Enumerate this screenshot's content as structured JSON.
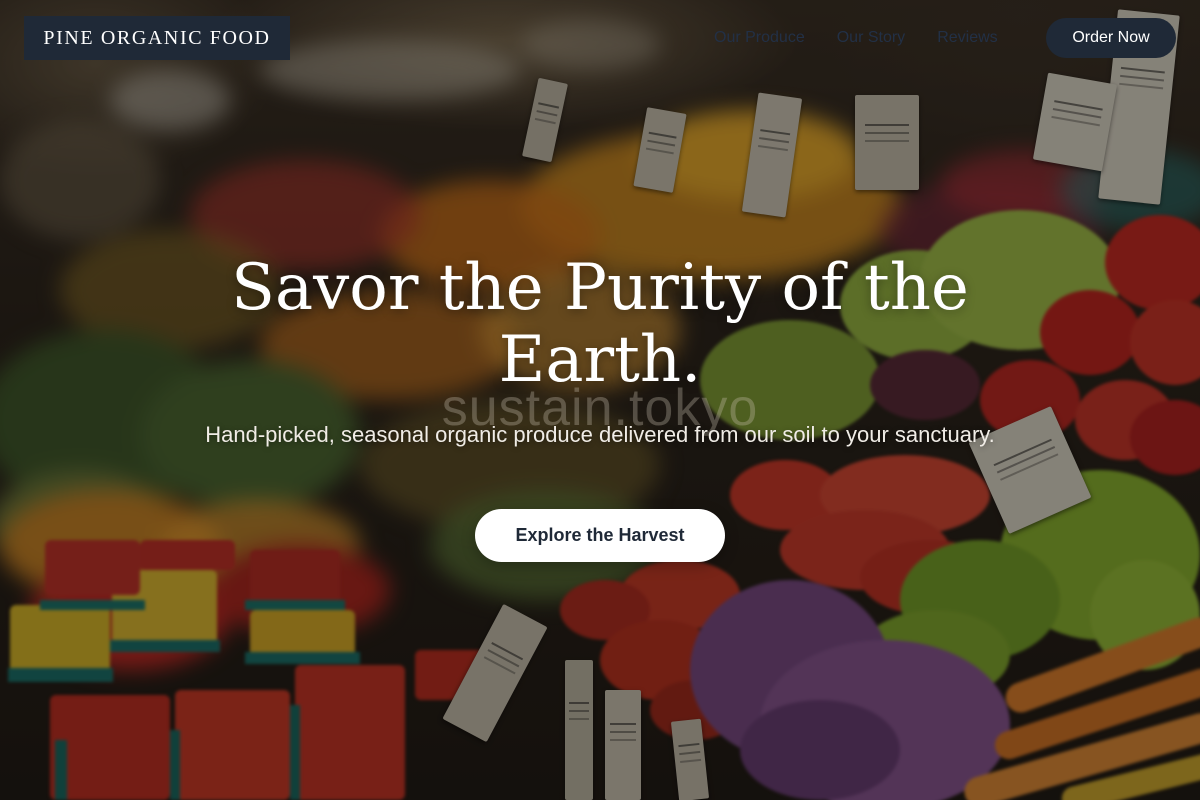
{
  "header": {
    "brand": "PINE ORGANIC FOOD",
    "nav": [
      {
        "label": "Our Produce"
      },
      {
        "label": "Our Story"
      },
      {
        "label": "Reviews"
      }
    ],
    "cta_label": "Order Now"
  },
  "hero": {
    "title": "Savor the Purity of the Earth.",
    "subtitle": "Hand-picked, seasonal organic produce delivered from our soil to your sanctuary.",
    "button_label": "Explore the Harvest",
    "watermark": "sustain.tokyo"
  },
  "colors": {
    "dark_navy": "#1f2937",
    "white": "#ffffff",
    "nav_text": "#223046"
  }
}
